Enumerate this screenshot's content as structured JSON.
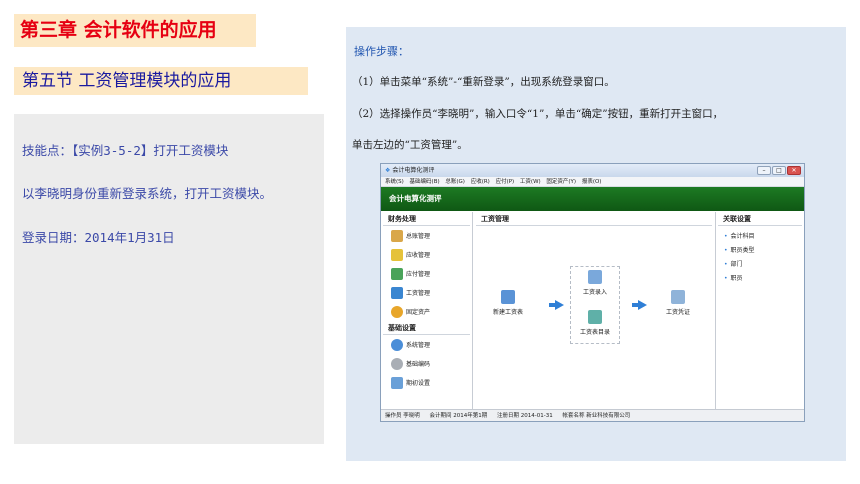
{
  "slide": {
    "chapter_title": "第三章 会计软件的应用",
    "section_title": "第五节 工资管理模块的应用",
    "skill_line": "技能点：【实例3-5-2】打开工资模块",
    "task_line": "以李晓明身份重新登录系统，打开工资模块。",
    "date_line": "登录日期：2014年1月31日"
  },
  "steps": {
    "header": "操作步骤：",
    "step1": "（1）单击菜单“系统”-“重新登录”，出现系统登录窗口。",
    "step2a": "（2）选择操作员“李晓明”，输入口令“1”，单击“确定”按钮，重新打开主窗口，",
    "step2b": "单击左边的“工资管理”。"
  },
  "app": {
    "title": "会计电算化测评",
    "menu": [
      "系统(S)",
      "基础编码(B)",
      "总账(G)",
      "应收(R)",
      "应付(P)",
      "工资(W)",
      "固定资产(Y)",
      "报表(O)"
    ],
    "banner": "会计电算化测评",
    "left": {
      "finance_header": "财务处理",
      "finance_items": [
        "总账管理",
        "应收管理",
        "应付管理",
        "工资管理",
        "固定资产"
      ],
      "basic_header": "基础设置",
      "basic_items": [
        "系统管理",
        "基础编码",
        "期初设置"
      ]
    },
    "center": {
      "header": "工资管理",
      "new_table": "新建工资表",
      "salary_entry": "工资录入",
      "salary_list": "工资表目录",
      "salary_voucher": "工资凭证"
    },
    "right": {
      "header": "关联设置",
      "items": [
        "会计科目",
        "职员类型",
        "部门",
        "职员"
      ]
    },
    "status": {
      "operator": "操作员  李晓明",
      "period": "会计期间  2014年第1期",
      "date": "注册日期  2014-01-31",
      "account": "帐套名称  新业科技有限公司"
    },
    "colors": {
      "banner": "#1d7a23",
      "accent": "#2f7fd6"
    }
  }
}
